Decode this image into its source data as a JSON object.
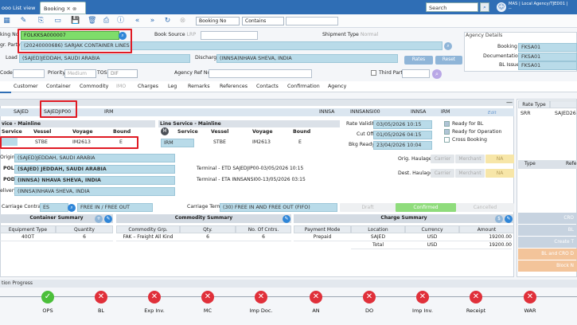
{
  "tabs": {
    "list_view": "ooo List view",
    "booking": "Booking"
  },
  "search": {
    "label": "Search"
  },
  "user": {
    "line1": "MAS | Local Agency/TJED01 |",
    "line2": "--"
  },
  "filter": {
    "field": "Booking No",
    "op": "Contains"
  },
  "header": {
    "booking_no_label": "king No",
    "booking_no": "FOLKKSA000007",
    "booking_source_label": "Book Source",
    "booking_source": "LRP",
    "shipment_type_label": "Shipment Type",
    "shipment_type": "Normal",
    "party_label": "gr. Party",
    "party": "(20240000686) SARJAK CONTAINER LINES",
    "load_label": "Load",
    "load": "(SAJED)JEDDAH, SAUDI ARABIA",
    "discharge_label": "Discharge",
    "discharge": "(INNSA)NHAVA SHEVA, INDIA",
    "rates_btn": "Rates",
    "reset_btn": "Reset",
    "code_label": "Code",
    "priority_label": "Priority",
    "priority": "Medium",
    "tos_label": "TOS",
    "tos": "DIF",
    "agency_ref_label": "Agency Ref No.",
    "third_party_label": "Third Party"
  },
  "agency": {
    "title": "Agency Details",
    "booking_label": "Booking",
    "booking": "FKSA01",
    "documentation_label": "Documentation",
    "documentation": "FKSA01",
    "bl_issue_label": "BL Issue",
    "bl_issue": "FKSA01"
  },
  "nav": [
    "Customer",
    "Container",
    "Commodity",
    "IMO",
    "Charges",
    "Leg",
    "Remarks",
    "References",
    "Contacts",
    "Confirmation",
    "Agency"
  ],
  "leg": {
    "cells": [
      "SAJED",
      "SAJEDJIP00",
      "IRM",
      "INNSA",
      "INNSANSI00",
      "INNSA",
      "IRM"
    ],
    "edit": "Edit",
    "main_title": "vice - Mainline",
    "service_hdr": "Service",
    "vessel_hdr": "Vessel",
    "voyage_hdr": "Voyage",
    "bound_hdr": "Bound",
    "vessel": "STBE",
    "voyage": "IM2613",
    "bound": "E",
    "svc2_title": "Line Service - Mainline",
    "m_icon": "M",
    "svc2_service": "IRM",
    "svc2_vessel": "STBE",
    "svc2_voyage": "IM2613",
    "svc2_bound": "E",
    "validity_label": "Rate Validity",
    "validity": "03/05/2026 10:15",
    "cutoff_label": "Cut Off",
    "cutoff": "01/05/2026 04:15",
    "bkg_ready_label": "Bkg Ready",
    "bkg_ready": "23/04/2026 10:04",
    "ready_bl": "Ready for BL",
    "ready_op": "Ready for Operation",
    "cross": "Cross Booking"
  },
  "route": {
    "origin_label": "Origin",
    "origin": "(SAJED)JEDDAH, SAUDI ARABIA",
    "pol_label": "POL",
    "pol": "(SAJED) JEDDAH, SAUDI ARABIA",
    "pod_label": "POD",
    "pod": "(INNSA) NHAVA SHEVA, INDIA",
    "delivery_label": "elivery",
    "delivery": "(INNSA)NHAVA SHEVA, INDIA",
    "etd": "Terminal - ETD SAJEDJIP00-03/05/2026 10:15",
    "eta": "Terminal - ETA INNSANSI00-13/05/2026 03:15",
    "orig_haulage": "Orig. Haulage",
    "dest_haulage": "Dest. Haulage",
    "carrier": "Carrier",
    "merchant": "Merchant",
    "na": "NA"
  },
  "contract": {
    "label": "Carriage Contract",
    "value": "ES",
    "free": "FREE IN / FREE OUT",
    "term_label": "Carriage Term",
    "term": "(30) FREE IN AND FREE OUT (FIFO)"
  },
  "status": {
    "draft": "Draft",
    "confirmed": "Confirmed",
    "cancelled": "Cancelled"
  },
  "container_summary": {
    "title": "Container Summary",
    "h1": "Equipment Type",
    "h2": "Quantity",
    "type": "40OT",
    "qty": "6"
  },
  "commodity_summary": {
    "title": "Commodity Summary",
    "h1": "Commodity Grp.",
    "h2": "Qty.",
    "h3": "No. Of Cntrs.",
    "grp": "FAK – Freight All Kind",
    "qty": "6",
    "cntrs": "6"
  },
  "charge_summary": {
    "title": "Charge Summary",
    "h1": "Payment Mode",
    "h2": "Location",
    "h3": "Currency",
    "h4": "Amount",
    "mode": "Prepaid",
    "loc": "SAJED",
    "cur": "USD",
    "amt": "19200.00",
    "total_label": "Total",
    "total_cur": "USD",
    "total_amt": "19200.00"
  },
  "right": {
    "rate_type": "Rate Type",
    "rt_val": "SRR",
    "rt_val2": "SAJED26",
    "type": "Type",
    "refe": "Refe",
    "b1": "CRO",
    "b2": "BL",
    "b3": "Create T",
    "b4": "BL and CRO D",
    "b5": "Block N"
  },
  "progress": {
    "title": "tion Progress",
    "steps": [
      "OPS",
      "BL",
      "Exp Inv.",
      "MC",
      "Imp Doc.",
      "AN",
      "DO",
      "Imp Inv.",
      "Receipt",
      "WAR"
    ]
  }
}
